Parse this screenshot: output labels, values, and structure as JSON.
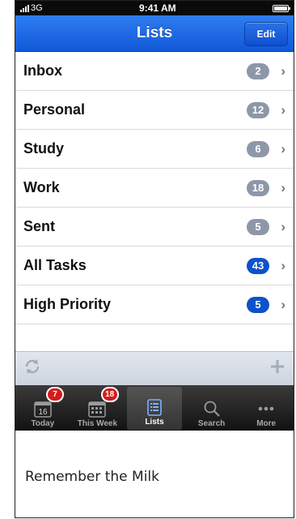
{
  "status_bar": {
    "carrier": "3G",
    "time": "9:41 AM"
  },
  "nav": {
    "title": "Lists",
    "edit_label": "Edit"
  },
  "lists": [
    {
      "label": "Inbox",
      "count": "2",
      "highlight": false
    },
    {
      "label": "Personal",
      "count": "12",
      "highlight": false
    },
    {
      "label": "Study",
      "count": "6",
      "highlight": false
    },
    {
      "label": "Work",
      "count": "18",
      "highlight": false
    },
    {
      "label": "Sent",
      "count": "5",
      "highlight": false
    },
    {
      "label": "All Tasks",
      "count": "43",
      "highlight": true
    },
    {
      "label": "High Priority",
      "count": "5",
      "highlight": true
    }
  ],
  "toolbar": {
    "refresh_icon": "refresh-icon",
    "add_icon": "plus-icon"
  },
  "tabs": [
    {
      "label": "Today",
      "icon": "calendar-day-icon",
      "badge": "7",
      "active": false
    },
    {
      "label": "This Week",
      "icon": "calendar-week-icon",
      "badge": "18",
      "active": false
    },
    {
      "label": "Lists",
      "icon": "lists-icon",
      "badge": "",
      "active": true
    },
    {
      "label": "Search",
      "icon": "search-icon",
      "badge": "",
      "active": false
    },
    {
      "label": "More",
      "icon": "more-icon",
      "badge": "",
      "active": false
    }
  ],
  "today_icon_number": "16",
  "caption": "Remember the Milk",
  "colors": {
    "nav_blue": "#1159d9",
    "badge_gray": "#8d97a8",
    "badge_blue": "#0e52c9",
    "tab_badge_red": "#d41b1b"
  }
}
